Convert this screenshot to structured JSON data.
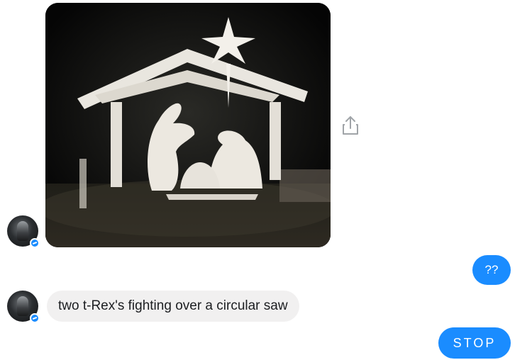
{
  "conversation": {
    "messages": [
      {
        "from": "other",
        "kind": "photo",
        "alt": ""
      },
      {
        "from": "me",
        "kind": "text",
        "text": "??"
      },
      {
        "from": "other",
        "kind": "text",
        "text": "two t-Rex's fighting over a circular saw"
      },
      {
        "from": "me",
        "kind": "text",
        "text": "STOP"
      }
    ]
  },
  "icons": {
    "share": "share-icon",
    "avatar_badge": "messenger-badge-icon"
  },
  "colors": {
    "outgoing_bubble": "#1a8cff",
    "incoming_bubble": "#f1f0f0",
    "background": "#ffffff",
    "incoming_text": "#1c1e21",
    "outgoing_text": "#ffffff"
  }
}
